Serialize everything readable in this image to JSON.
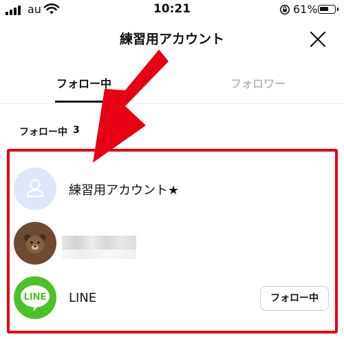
{
  "status_bar": {
    "carrier": "au",
    "time": "10:21",
    "battery_percent": "61%",
    "battery_level": 0.61
  },
  "header": {
    "title": "練習用アカウント"
  },
  "tabs": [
    {
      "label": "フォロー中",
      "active": true
    },
    {
      "label": "フォロワー",
      "active": false
    }
  ],
  "section": {
    "label": "フォロー中",
    "count": "3"
  },
  "list": [
    {
      "name": "練習用アカウント★",
      "avatar": "default-user-icon"
    },
    {
      "name": "",
      "avatar": "brown-bear-avatar",
      "name_redacted": true
    },
    {
      "name": "LINE",
      "avatar": "line-logo",
      "logo_text": "LINE",
      "button_label": "フォロー中"
    }
  ],
  "colors": {
    "highlight": "#e60012",
    "line_green": "#4cc22a",
    "inactive_tab": "#b8b8b8",
    "avatar_default_bg": "#dfe8f8",
    "bear_brown": "#6e4a31"
  }
}
